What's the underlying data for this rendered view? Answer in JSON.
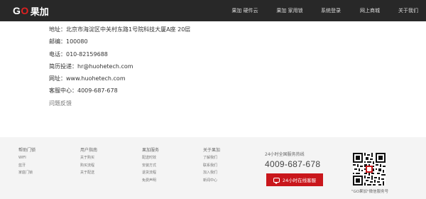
{
  "header": {
    "logo_go": "GO",
    "logo_cn": "果加",
    "nav": [
      {
        "label": "果加 硬件云"
      },
      {
        "label": "果加 家用锁"
      },
      {
        "label": "系统登录"
      },
      {
        "label": "网上商城"
      },
      {
        "label": "关于我们"
      }
    ]
  },
  "contact": {
    "address": "地址：北京市海淀区中关村东路1号院科技大厦A座 20层",
    "zipcode": "邮编：100080",
    "phone": "电话：010-82159688",
    "resume": "简历投递：hr@huohetech.com",
    "website": "网址：www.huohetech.com",
    "service": "客服中心：4009-687-678",
    "feedback": "问题反馈"
  },
  "footer": {
    "columns": [
      {
        "title": "帮助门锁",
        "items": [
          "WIFI",
          "蓝牙",
          "家庭门锁"
        ]
      },
      {
        "title": "用户指南",
        "items": [
          "关于购买",
          "购买流程",
          "关于配送"
        ]
      },
      {
        "title": "果加服务",
        "items": [
          "配送时效",
          "安装方式",
          "退货流程",
          "免费声明"
        ]
      },
      {
        "title": "关于果加",
        "items": [
          "了解我们",
          "联系我们",
          "加入我们",
          "新闻中心"
        ]
      }
    ],
    "hotline_label": "24小时全国服务热线",
    "hotline_number": "4009-687-678",
    "online_service": "24小时在线客服",
    "qr_caption": "\"GO果加\"微信服务号"
  },
  "colors": {
    "header_bg": "#282828",
    "accent": "#c9171c",
    "footer_bg": "#f4f4f4"
  }
}
